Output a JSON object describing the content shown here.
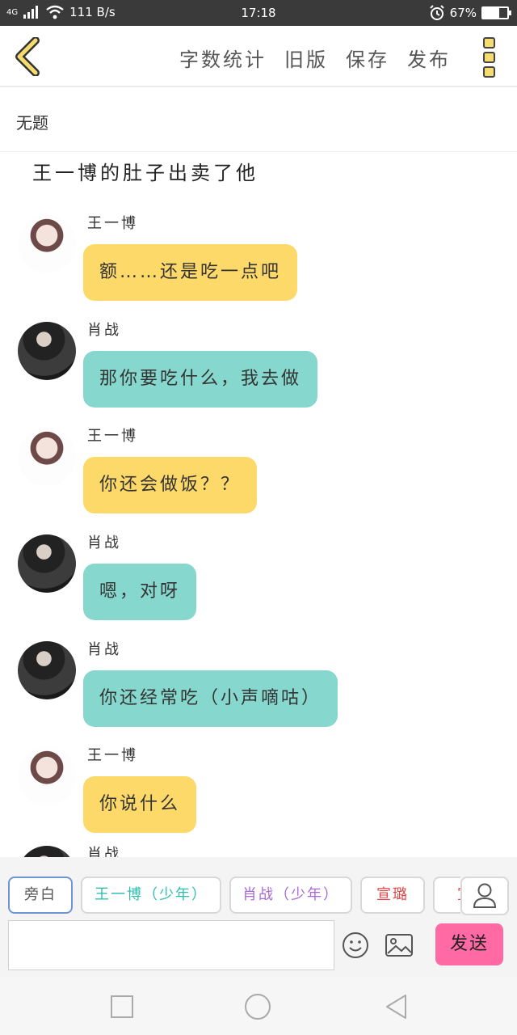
{
  "status_bar": {
    "network": "4G",
    "speed": "111 B/s",
    "time": "17:18",
    "battery": "67%",
    "battery_level": 0.67
  },
  "toolbar": {
    "actions": [
      "字数统计",
      "旧版",
      "保存",
      "发布"
    ]
  },
  "document": {
    "title": "无题",
    "story_title": "王一博的肚子出卖了他"
  },
  "messages": [
    {
      "speaker": "王一博",
      "text": "额……还是吃一点吧",
      "color": "#fdd96a"
    },
    {
      "speaker": "肖战",
      "text": "那你要吃什么，我去做",
      "color": "#86d8cf"
    },
    {
      "speaker": "王一博",
      "text": "你还会做饭？？",
      "color": "#fdd96a"
    },
    {
      "speaker": "肖战",
      "text": "嗯，对呀",
      "color": "#86d8cf"
    },
    {
      "speaker": "肖战",
      "text": "你还经常吃（小声嘀咕）",
      "color": "#86d8cf"
    },
    {
      "speaker": "王一博",
      "text": "你说什么",
      "color": "#fdd96a"
    },
    {
      "speaker": "肖战",
      "text": "",
      "color": "#86d8cf"
    }
  ],
  "roles": [
    {
      "label": "旁白",
      "color": "#555555"
    },
    {
      "label": "王一博（少年）",
      "color": "#2fbfb0"
    },
    {
      "label": "肖战（少年）",
      "color": "#a86ad6"
    },
    {
      "label": "宣璐",
      "color": "#e04646"
    },
    {
      "label": "宣",
      "color": "#e04646"
    }
  ],
  "composer": {
    "input_value": "",
    "send_label": "发送"
  },
  "colors": {
    "accent_yellow": "#fdd96a",
    "accent_teal": "#86d8cf",
    "send_pink": "#ff6aa4"
  },
  "icons": {
    "back": "chevron-left-icon",
    "more": "more-vertical-icon",
    "emoji": "smiley-icon",
    "image": "image-icon",
    "role": "person-icon",
    "nav": [
      "square-icon",
      "circle-icon",
      "triangle-back-icon"
    ]
  }
}
